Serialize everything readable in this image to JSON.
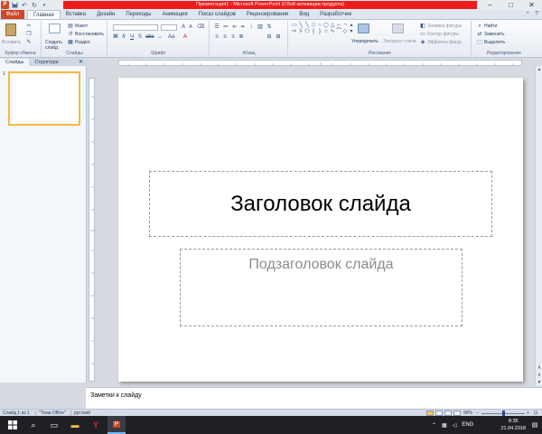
{
  "window": {
    "title": "Презентация1 - Microsoft PowerPoint (Сбой активации продукта)",
    "app_icon": "P",
    "controls": {
      "minimize": "–",
      "maximize": "□",
      "close": "✕"
    }
  },
  "ribbon": {
    "file_tab": "Файл",
    "tabs": [
      "Главная",
      "Вставка",
      "Дизайн",
      "Переходы",
      "Анимация",
      "Показ слайдов",
      "Рецензирование",
      "Вид",
      "Разработчик"
    ],
    "active_tab": "Главная",
    "groups": {
      "clipboard": {
        "label": "Буфер обмена",
        "paste": "Вставить"
      },
      "slides": {
        "label": "Слайды",
        "new_slide": "Создать слайд",
        "layout": "Макет",
        "reset": "Восстановить",
        "section": "Раздел"
      },
      "font": {
        "label": "Шрифт"
      },
      "paragraph": {
        "label": "Абзац"
      },
      "drawing": {
        "label": "Рисование",
        "arrange": "Упорядочить",
        "quick_styles": "Экспресс-стили",
        "shape_fill": "Заливка фигуры",
        "shape_outline": "Контур фигуры",
        "shape_effects": "Эффекты фигур"
      },
      "editing": {
        "label": "Редактирование",
        "find": "Найти",
        "replace": "Заменить",
        "select": "Выделить"
      }
    }
  },
  "left_pane": {
    "tabs": [
      "Слайды",
      "Структура"
    ],
    "close": "✕",
    "slide_number": "1"
  },
  "slide": {
    "title_placeholder": "Заголовок слайда",
    "subtitle_placeholder": "Подзаголовок слайда"
  },
  "notes": {
    "placeholder": "Заметки к слайду"
  },
  "status_bar": {
    "slide_info": "Слайд 1 из 1",
    "theme": "\"Тема Office\"",
    "language": "русский",
    "zoom": "99%",
    "zoom_fraction": 0.5
  },
  "taskbar": {
    "language": "ENG",
    "time": "8:35",
    "date": "21.04.2018"
  },
  "colors": {
    "accent": "#d24726",
    "title_bar_red": "#ef1c1c",
    "selected_thumb": "#f5b840"
  }
}
